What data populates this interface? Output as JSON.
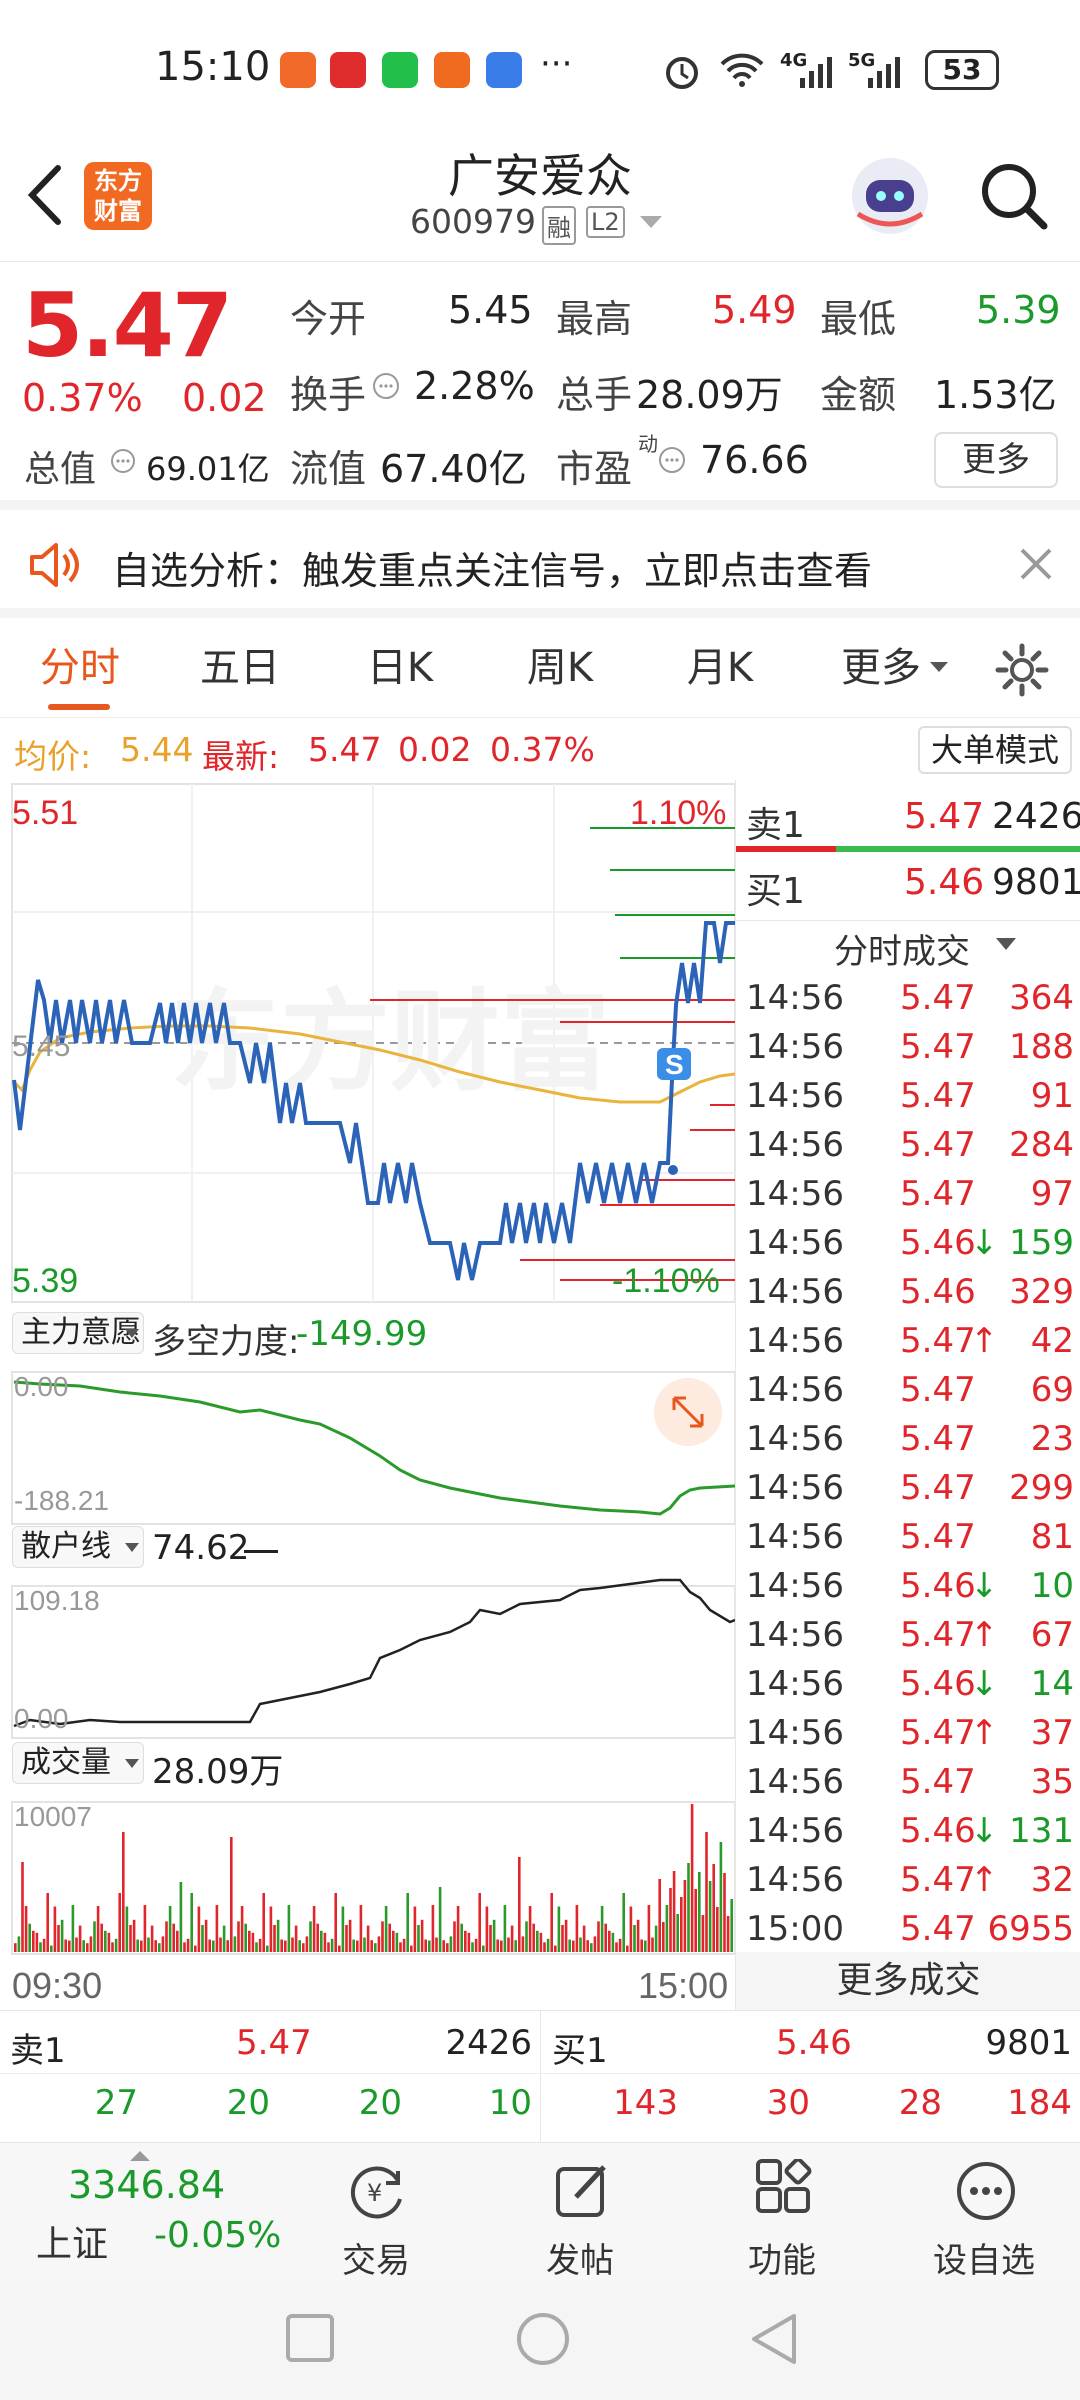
{
  "status": {
    "time": "15:10",
    "battery": "53",
    "net1": "4G",
    "net2": "5G",
    "more": "···"
  },
  "header": {
    "logo_text": "东方财富",
    "title": "广安爱众",
    "code": "600979",
    "tag_rong": "融",
    "tag_l2": "L2"
  },
  "quote": {
    "price": "5.47",
    "pct": "0.37%",
    "change": "0.02",
    "open_label": "今开",
    "open": "5.45",
    "high_label": "最高",
    "high": "5.49",
    "low_label": "最低",
    "low": "5.39",
    "turnover_label": "换手",
    "turnover": "2.28%",
    "vol_label": "总手",
    "vol": "28.09万",
    "amount_label": "金额",
    "amount": "1.53亿",
    "mcap_label": "总值",
    "mcap": "69.01亿",
    "float_label": "流值",
    "float": "67.40亿",
    "pe_label": "市盈",
    "pe_sup": "动",
    "pe": "76.66",
    "more_button": "更多"
  },
  "notice": {
    "text": "自选分析：触发重点关注信号，立即点击查看"
  },
  "tabs": [
    "分时",
    "五日",
    "日K",
    "周K",
    "月K",
    "更多"
  ],
  "avgline": {
    "avg_label": "均价:",
    "avg": "5.44",
    "latest_label": "最新:",
    "latest": "5.47",
    "chg": "0.02",
    "pct": "0.37%",
    "mode_button": "大单模式"
  },
  "price_chart": {
    "top_price": "5.51",
    "top_pct": "1.10%",
    "bottom_price": "5.39",
    "bottom_pct": "-1.10%",
    "mid_price": "5.45",
    "watermark": "东方财富",
    "badge": "S"
  },
  "indicator1": {
    "name": "主力意愿",
    "label": "多空力度:",
    "value": "-149.99",
    "top": "0.00",
    "bottom": "-188.21"
  },
  "indicator2": {
    "name": "散户线",
    "value": "74.62",
    "top": "109.18",
    "bottom": "0.00"
  },
  "indicator3": {
    "name": "成交量",
    "value": "28.09万",
    "top": "10007"
  },
  "time_axis": {
    "start": "09:30",
    "end": "15:00"
  },
  "book": {
    "sell_label": "卖1",
    "sell_price": "5.47",
    "sell_vol": "2426",
    "buy_label": "买1",
    "buy_price": "5.46",
    "buy_vol": "9801",
    "ticks_header": "分时成交",
    "more_ticks": "更多成交"
  },
  "ticks": [
    {
      "time": "14:56",
      "price": "5.47",
      "arrow": "",
      "vol": "364",
      "dir": "up"
    },
    {
      "time": "14:56",
      "price": "5.47",
      "arrow": "",
      "vol": "188",
      "dir": "up"
    },
    {
      "time": "14:56",
      "price": "5.47",
      "arrow": "",
      "vol": "91",
      "dir": "up"
    },
    {
      "time": "14:56",
      "price": "5.47",
      "arrow": "",
      "vol": "284",
      "dir": "up"
    },
    {
      "time": "14:56",
      "price": "5.47",
      "arrow": "",
      "vol": "97",
      "dir": "up"
    },
    {
      "time": "14:56",
      "price": "5.46",
      "arrow": "↓",
      "vol": "159",
      "dir": "down"
    },
    {
      "time": "14:56",
      "price": "5.46",
      "arrow": "",
      "vol": "329",
      "dir": "up"
    },
    {
      "time": "14:56",
      "price": "5.47",
      "arrow": "↑",
      "vol": "42",
      "dir": "up"
    },
    {
      "time": "14:56",
      "price": "5.47",
      "arrow": "",
      "vol": "69",
      "dir": "up"
    },
    {
      "time": "14:56",
      "price": "5.47",
      "arrow": "",
      "vol": "23",
      "dir": "up"
    },
    {
      "time": "14:56",
      "price": "5.47",
      "arrow": "",
      "vol": "299",
      "dir": "up"
    },
    {
      "time": "14:56",
      "price": "5.47",
      "arrow": "",
      "vol": "81",
      "dir": "up"
    },
    {
      "time": "14:56",
      "price": "5.46",
      "arrow": "↓",
      "vol": "10",
      "dir": "down"
    },
    {
      "time": "14:56",
      "price": "5.47",
      "arrow": "↑",
      "vol": "67",
      "dir": "up"
    },
    {
      "time": "14:56",
      "price": "5.46",
      "arrow": "↓",
      "vol": "14",
      "dir": "down"
    },
    {
      "time": "14:56",
      "price": "5.47",
      "arrow": "↑",
      "vol": "37",
      "dir": "up"
    },
    {
      "time": "14:56",
      "price": "5.47",
      "arrow": "",
      "vol": "35",
      "dir": "up"
    },
    {
      "time": "14:56",
      "price": "5.46",
      "arrow": "↓",
      "vol": "131",
      "dir": "down"
    },
    {
      "time": "14:56",
      "price": "5.47",
      "arrow": "↑",
      "vol": "32",
      "dir": "up"
    },
    {
      "time": "15:00",
      "price": "5.47",
      "arrow": "",
      "vol": "6955",
      "dir": "up"
    }
  ],
  "bottom_quote": {
    "sell_label": "卖1",
    "sell_price": "5.47",
    "sell_vol": "2426",
    "buy_label": "买1",
    "buy_price": "5.46",
    "buy_vol": "9801",
    "sell_nums": [
      "27",
      "20",
      "20",
      "10"
    ],
    "buy_nums": [
      "143",
      "30",
      "28",
      "184"
    ]
  },
  "tabbar": {
    "index_value": "3346.84",
    "index_name": "上证",
    "index_pct": "-0.05%",
    "trade": "交易",
    "post": "发帖",
    "func": "功能",
    "watch": "设自选"
  },
  "colors": {
    "accent": "#e8581e",
    "up": "#e0262b",
    "down": "#1a9a2a",
    "price_line": "#2b63b8",
    "avg_line": "#e9b33c"
  }
}
